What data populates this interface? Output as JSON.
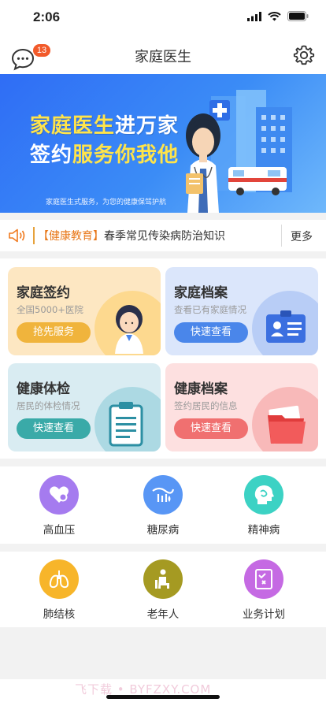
{
  "status": {
    "time": "2:06"
  },
  "nav": {
    "title": "家庭医生",
    "badge": "13"
  },
  "banner": {
    "line1_highlight": "家庭医生",
    "line1_rest": "进万家",
    "line2_prefix": "签约",
    "line2_highlight": "服务你我他",
    "subtitle": "家庭医生式服务，为您的健康保驾护航"
  },
  "notice": {
    "tag": "【健康教育】",
    "text": "春季常见传染病防治知识",
    "more": "更多"
  },
  "cards": [
    {
      "title": "家庭签约",
      "sub": "全国5000+医院",
      "btn": "抢先服务",
      "bg": "#fde7c2",
      "btn_color": "#f0b43c",
      "art_bg": "#fdd98f"
    },
    {
      "title": "家庭档案",
      "sub": "查看已有家庭情况",
      "btn": "快速查看",
      "bg": "#dbe6fb",
      "btn_color": "#4a86ea",
      "art_bg": "#b8cdf6"
    },
    {
      "title": "健康体检",
      "sub": "居民的体检情况",
      "btn": "快速查看",
      "bg": "#d9ecf2",
      "btn_color": "#3aaaa8",
      "art_bg": "#acd9e3"
    },
    {
      "title": "健康档案",
      "sub": "签约居民的信息",
      "btn": "快速查看",
      "bg": "#fde0e0",
      "btn_color": "#f07070",
      "art_bg": "#f8b9b9"
    }
  ],
  "services_row1": [
    {
      "label": "高血压",
      "icon": "heart-icon",
      "color": "#a57bef"
    },
    {
      "label": "糖尿病",
      "icon": "glucose-icon",
      "color": "#5896f5"
    },
    {
      "label": "精神病",
      "icon": "brain-icon",
      "color": "#3cd2c4"
    }
  ],
  "services_row2": [
    {
      "label": "肺结核",
      "icon": "lungs-icon",
      "color": "#f7b52a"
    },
    {
      "label": "老年人",
      "icon": "elderly-icon",
      "color": "#a59a22"
    },
    {
      "label": "业务计划",
      "icon": "plan-icon",
      "color": "#c56ae3"
    }
  ],
  "watermark": "飞下载 • BYFZXY.COM"
}
